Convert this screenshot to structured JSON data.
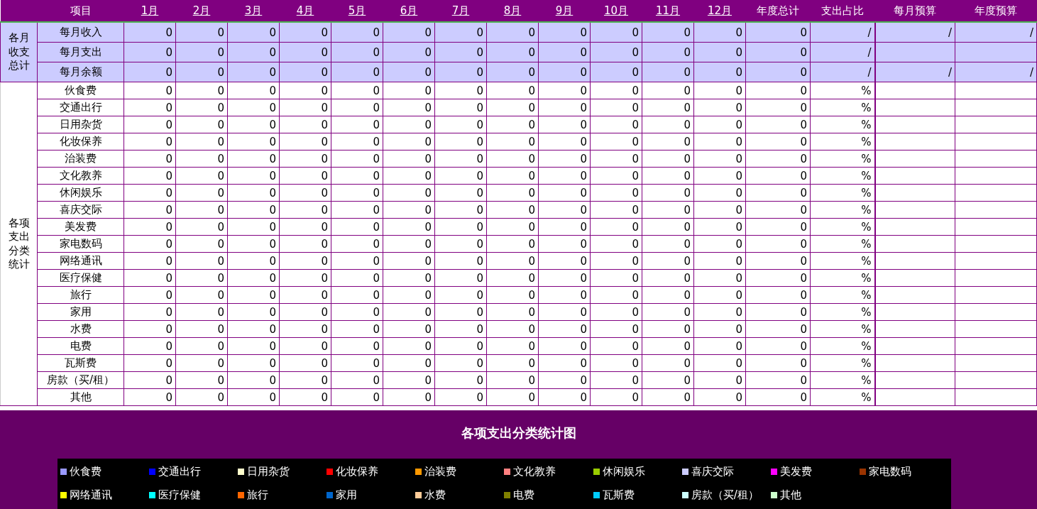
{
  "header": {
    "item_label": "项目",
    "months": [
      "1月",
      "2月",
      "3月",
      "4月",
      "5月",
      "6月",
      "7月",
      "8月",
      "9月",
      "10月",
      "11月",
      "12月"
    ],
    "columns": [
      "年度总计",
      "支出占比",
      "每月预算",
      "年度预算"
    ]
  },
  "summary": {
    "group_label": "各月收支总计",
    "rows": [
      {
        "label": "每月收入",
        "values": [
          "0",
          "0",
          "0",
          "0",
          "0",
          "0",
          "0",
          "0",
          "0",
          "0",
          "0",
          "0",
          "0"
        ],
        "ratio": "/",
        "monthly_budget": "/",
        "annual_budget": "/"
      },
      {
        "label": "每月支出",
        "values": [
          "0",
          "0",
          "0",
          "0",
          "0",
          "0",
          "0",
          "0",
          "0",
          "0",
          "0",
          "0",
          "0"
        ],
        "ratio": "/"
      },
      {
        "label": "每月余额",
        "values": [
          "0",
          "0",
          "0",
          "0",
          "0",
          "0",
          "0",
          "0",
          "0",
          "0",
          "0",
          "0",
          "0"
        ],
        "ratio": "/",
        "monthly_budget": "/",
        "annual_budget": "/"
      }
    ]
  },
  "categories": {
    "group_label": "各项支出分类统计",
    "rows": [
      {
        "label": "伙食费",
        "values": [
          "0",
          "0",
          "0",
          "0",
          "0",
          "0",
          "0",
          "0",
          "0",
          "0",
          "0",
          "0",
          "0"
        ],
        "ratio": "%"
      },
      {
        "label": "交通出行",
        "values": [
          "0",
          "0",
          "0",
          "0",
          "0",
          "0",
          "0",
          "0",
          "0",
          "0",
          "0",
          "0",
          "0"
        ],
        "ratio": "%"
      },
      {
        "label": "日用杂货",
        "values": [
          "0",
          "0",
          "0",
          "0",
          "0",
          "0",
          "0",
          "0",
          "0",
          "0",
          "0",
          "0",
          "0"
        ],
        "ratio": "%"
      },
      {
        "label": "化妆保养",
        "values": [
          "0",
          "0",
          "0",
          "0",
          "0",
          "0",
          "0",
          "0",
          "0",
          "0",
          "0",
          "0",
          "0"
        ],
        "ratio": "%"
      },
      {
        "label": "治装费",
        "values": [
          "0",
          "0",
          "0",
          "0",
          "0",
          "0",
          "0",
          "0",
          "0",
          "0",
          "0",
          "0",
          "0"
        ],
        "ratio": "%"
      },
      {
        "label": "文化教养",
        "values": [
          "0",
          "0",
          "0",
          "0",
          "0",
          "0",
          "0",
          "0",
          "0",
          "0",
          "0",
          "0",
          "0"
        ],
        "ratio": "%"
      },
      {
        "label": "休闲娱乐",
        "values": [
          "0",
          "0",
          "0",
          "0",
          "0",
          "0",
          "0",
          "0",
          "0",
          "0",
          "0",
          "0",
          "0"
        ],
        "ratio": "%"
      },
      {
        "label": "喜庆交际",
        "values": [
          "0",
          "0",
          "0",
          "0",
          "0",
          "0",
          "0",
          "0",
          "0",
          "0",
          "0",
          "0",
          "0"
        ],
        "ratio": "%"
      },
      {
        "label": "美发费",
        "values": [
          "0",
          "0",
          "0",
          "0",
          "0",
          "0",
          "0",
          "0",
          "0",
          "0",
          "0",
          "0",
          "0"
        ],
        "ratio": "%"
      },
      {
        "label": "家电数码",
        "values": [
          "0",
          "0",
          "0",
          "0",
          "0",
          "0",
          "0",
          "0",
          "0",
          "0",
          "0",
          "0",
          "0"
        ],
        "ratio": "%"
      },
      {
        "label": "网络通讯",
        "values": [
          "0",
          "0",
          "0",
          "0",
          "0",
          "0",
          "0",
          "0",
          "0",
          "0",
          "0",
          "0",
          "0"
        ],
        "ratio": "%"
      },
      {
        "label": "医疗保健",
        "values": [
          "0",
          "0",
          "0",
          "0",
          "0",
          "0",
          "0",
          "0",
          "0",
          "0",
          "0",
          "0",
          "0"
        ],
        "ratio": "%"
      },
      {
        "label": "旅行",
        "values": [
          "0",
          "0",
          "0",
          "0",
          "0",
          "0",
          "0",
          "0",
          "0",
          "0",
          "0",
          "0",
          "0"
        ],
        "ratio": "%"
      },
      {
        "label": "家用",
        "values": [
          "0",
          "0",
          "0",
          "0",
          "0",
          "0",
          "0",
          "0",
          "0",
          "0",
          "0",
          "0",
          "0"
        ],
        "ratio": "%"
      },
      {
        "label": "水费",
        "values": [
          "0",
          "0",
          "0",
          "0",
          "0",
          "0",
          "0",
          "0",
          "0",
          "0",
          "0",
          "0",
          "0"
        ],
        "ratio": "%"
      },
      {
        "label": "电费",
        "values": [
          "0",
          "0",
          "0",
          "0",
          "0",
          "0",
          "0",
          "0",
          "0",
          "0",
          "0",
          "0",
          "0"
        ],
        "ratio": "%"
      },
      {
        "label": "瓦斯费",
        "values": [
          "0",
          "0",
          "0",
          "0",
          "0",
          "0",
          "0",
          "0",
          "0",
          "0",
          "0",
          "0",
          "0"
        ],
        "ratio": "%"
      },
      {
        "label": "房款（买/租）",
        "values": [
          "0",
          "0",
          "0",
          "0",
          "0",
          "0",
          "0",
          "0",
          "0",
          "0",
          "0",
          "0",
          "0"
        ],
        "ratio": "%"
      },
      {
        "label": "其他",
        "values": [
          "0",
          "0",
          "0",
          "0",
          "0",
          "0",
          "0",
          "0",
          "0",
          "0",
          "0",
          "0",
          "0"
        ],
        "ratio": "%"
      }
    ]
  },
  "chart": {
    "title": "各项支出分类统计图",
    "legend": [
      {
        "label": "伙食费",
        "color": "#9999ff"
      },
      {
        "label": "交通出行",
        "color": "#0000ff"
      },
      {
        "label": "日用杂货",
        "color": "#ffffcc"
      },
      {
        "label": "化妆保养",
        "color": "#ff0000"
      },
      {
        "label": "治装费",
        "color": "#ff9900"
      },
      {
        "label": "文化教养",
        "color": "#ff8080"
      },
      {
        "label": "休闲娱乐",
        "color": "#99cc00"
      },
      {
        "label": "喜庆交际",
        "color": "#ccccff"
      },
      {
        "label": "美发费",
        "color": "#ff00ff"
      },
      {
        "label": "家电数码",
        "color": "#993300"
      },
      {
        "label": "网络通讯",
        "color": "#ffff00"
      },
      {
        "label": "医疗保健",
        "color": "#00ffff"
      },
      {
        "label": "旅行",
        "color": "#ff6600"
      },
      {
        "label": "家用",
        "color": "#0066cc"
      },
      {
        "label": "水费",
        "color": "#ffcc99"
      },
      {
        "label": "电费",
        "color": "#808000"
      },
      {
        "label": "瓦斯费",
        "color": "#00ccff"
      },
      {
        "label": "房款（买/租）",
        "color": "#ccffff"
      },
      {
        "label": "其他",
        "color": "#ccffcc"
      }
    ]
  }
}
